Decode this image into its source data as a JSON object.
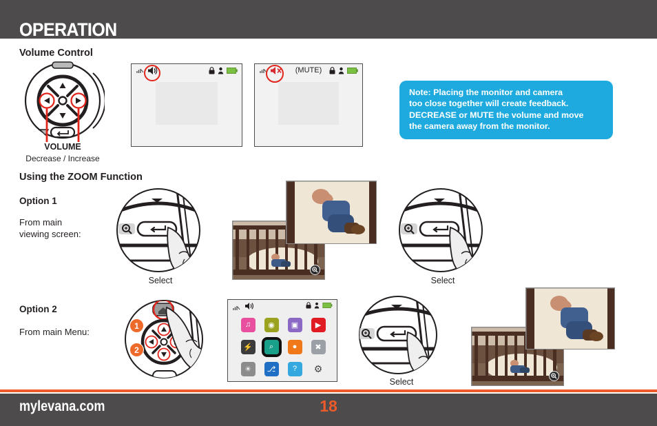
{
  "header": {
    "title": "OPERATION"
  },
  "volume": {
    "section_title": "Volume Control",
    "remote_label": "VOLUME",
    "remote_caption": "Decrease / Increase",
    "screen_normal": {
      "signal": "signal-icon",
      "volume_icon": "speaker-on-icon",
      "lock": "lock-icon",
      "user": "user-icon",
      "battery": "battery-icon"
    },
    "screen_mute": {
      "signal": "signal-icon",
      "volume_icon": "speaker-mute-icon",
      "label": "(MUTE)",
      "lock": "lock-icon",
      "user": "user-icon",
      "battery": "battery-icon"
    }
  },
  "note": {
    "line1": "Note: Placing the monitor and camera",
    "line2": "too close together will create feedback.",
    "line3": "DECREASE or MUTE the volume and move",
    "line4": "the camera away from the monitor."
  },
  "zoom_section": {
    "section_title": "Using the ZOOM Function",
    "option1": {
      "label": "Option 1",
      "instruction_line1": "From main",
      "instruction_line2": "viewing screen:",
      "select_caption_left": "Select",
      "select_caption_right": "Select"
    },
    "option2": {
      "label": "Option 2",
      "instruction": "From main Menu:",
      "step1": "1",
      "step2": "2",
      "select_caption": "Select"
    }
  },
  "menu_screen": {
    "status": {
      "signal": "signal-icon",
      "volume": "speaker-on-icon",
      "lock": "lock-icon",
      "user": "user-icon",
      "battery": "battery-icon"
    },
    "icons": [
      {
        "name": "lullaby-icon",
        "glyph": "♫",
        "color": "#e8509f"
      },
      {
        "name": "camera-icon",
        "glyph": "◉",
        "color": "#9aa220"
      },
      {
        "name": "video-record-icon",
        "glyph": "▣",
        "color": "#8b68c4"
      },
      {
        "name": "playback-icon",
        "glyph": "▶",
        "color": "#e01b24"
      },
      {
        "name": "battery-off-icon",
        "glyph": "⚡",
        "color": "#3c3c3c"
      },
      {
        "name": "zoom-icon",
        "glyph": "⌕",
        "color": "#19a08a"
      },
      {
        "name": "alert-person-icon",
        "glyph": "●",
        "color": "#f07818"
      },
      {
        "name": "disabled-icon",
        "glyph": "✖",
        "color": "#9aa0a6"
      },
      {
        "name": "brightness-icon",
        "glyph": "☀",
        "color": "#8c8c8c"
      },
      {
        "name": "pairing-icon",
        "glyph": "⎇",
        "color": "#1f6fc4"
      },
      {
        "name": "help-icon",
        "glyph": "?",
        "color": "#35a8e0"
      },
      {
        "name": "settings-icon",
        "glyph": "⚙",
        "color": "#efefef"
      }
    ],
    "selected_index": 5
  },
  "footer": {
    "site": "mylevana.com",
    "page": "18"
  },
  "colors": {
    "dark_bar": "#4d4b4c",
    "orange": "#ee5b2b",
    "note_blue": "#1eaade",
    "red_highlight": "#e1251b",
    "step_bubble": "#ee6a2b"
  }
}
